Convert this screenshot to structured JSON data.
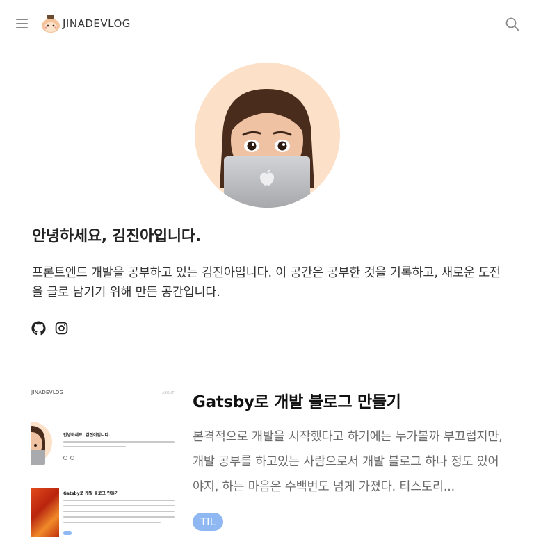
{
  "header": {
    "logo_text": "JINADEVLOG",
    "menu_icon": "hamburger-menu-icon",
    "search_icon": "search-icon"
  },
  "profile": {
    "title": "안녕하세요, 김진아입니다.",
    "description": "프론트엔드 개발을 공부하고 있는 김진아입니다. 이 공간은 공부한 것을 기록하고, 새로운 도전을 글로 남기기 위해 만든 공간입니다.",
    "social": [
      {
        "icon": "github-icon"
      },
      {
        "icon": "instagram-icon"
      }
    ]
  },
  "posts": [
    {
      "title": "Gatsby로 개발 블로그 만들기",
      "excerpt": "본격적으로 개발을 시작했다고 하기에는 누가볼까 부끄럽지만, 개발 공부를 하고있는 사람으로서 개발 블로그 하나 정도 있어야지, 하는 마음은 수백번도 넘게 가졌다. 티스토리...",
      "tag": "TIL",
      "thumbnail": {
        "logo_text": "JINADEVLOG",
        "about_text": "ABOUT",
        "intro_title": "안녕하세요, 김진아입니다.",
        "post_title": "Gatsby로 개발 블로그 만들기"
      }
    }
  ],
  "colors": {
    "tag_bg": "#8fb8f2",
    "avatar_bg": "#fde0c8",
    "text_primary": "#222222",
    "text_muted": "#6b6b6b"
  }
}
